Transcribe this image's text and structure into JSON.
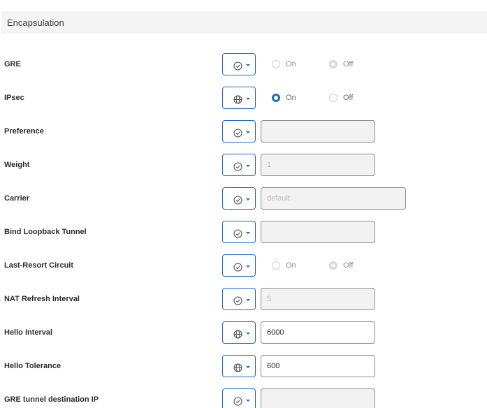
{
  "section": {
    "title": "Encapsulation"
  },
  "rows": [
    {
      "label": "GRE",
      "scope": "default",
      "control": "radio",
      "on_label": "On",
      "off_label": "Off",
      "selected": "Off",
      "enabled": false
    },
    {
      "label": "IPsec",
      "scope": "global",
      "control": "radio",
      "on_label": "On",
      "off_label": "Off",
      "selected": "On",
      "enabled": true
    },
    {
      "label": "Preference",
      "scope": "default",
      "control": "text",
      "placeholder": "",
      "value": ""
    },
    {
      "label": "Weight",
      "scope": "default",
      "control": "text",
      "placeholder": "1",
      "value": ""
    },
    {
      "label": "Carrier",
      "scope": "default",
      "control": "text-wide",
      "placeholder": "default",
      "value": ""
    },
    {
      "label": "Bind Loopback Tunnel",
      "scope": "default",
      "control": "text",
      "placeholder": "",
      "value": ""
    },
    {
      "label": "Last-Resort Circuit",
      "scope": "default",
      "control": "radio",
      "on_label": "On",
      "off_label": "Off",
      "selected": "Off",
      "enabled": false
    },
    {
      "label": "NAT Refresh Interval",
      "scope": "default",
      "control": "text",
      "placeholder": "5",
      "value": ""
    },
    {
      "label": "Hello Interval",
      "scope": "global",
      "control": "text",
      "placeholder": "",
      "value": "6000"
    },
    {
      "label": "Hello Tolerance",
      "scope": "global",
      "control": "text",
      "placeholder": "",
      "value": "600"
    },
    {
      "label": "GRE tunnel destination IP",
      "scope": "default",
      "control": "text",
      "placeholder": "",
      "value": ""
    }
  ],
  "icons": {
    "default": "check-circle-icon",
    "global": "globe-icon",
    "caret": "caret-down-icon"
  },
  "colors": {
    "accent": "#1d69cc",
    "header_bg": "#f4f4f5",
    "disabled_field_bg": "#f2f2f2"
  }
}
